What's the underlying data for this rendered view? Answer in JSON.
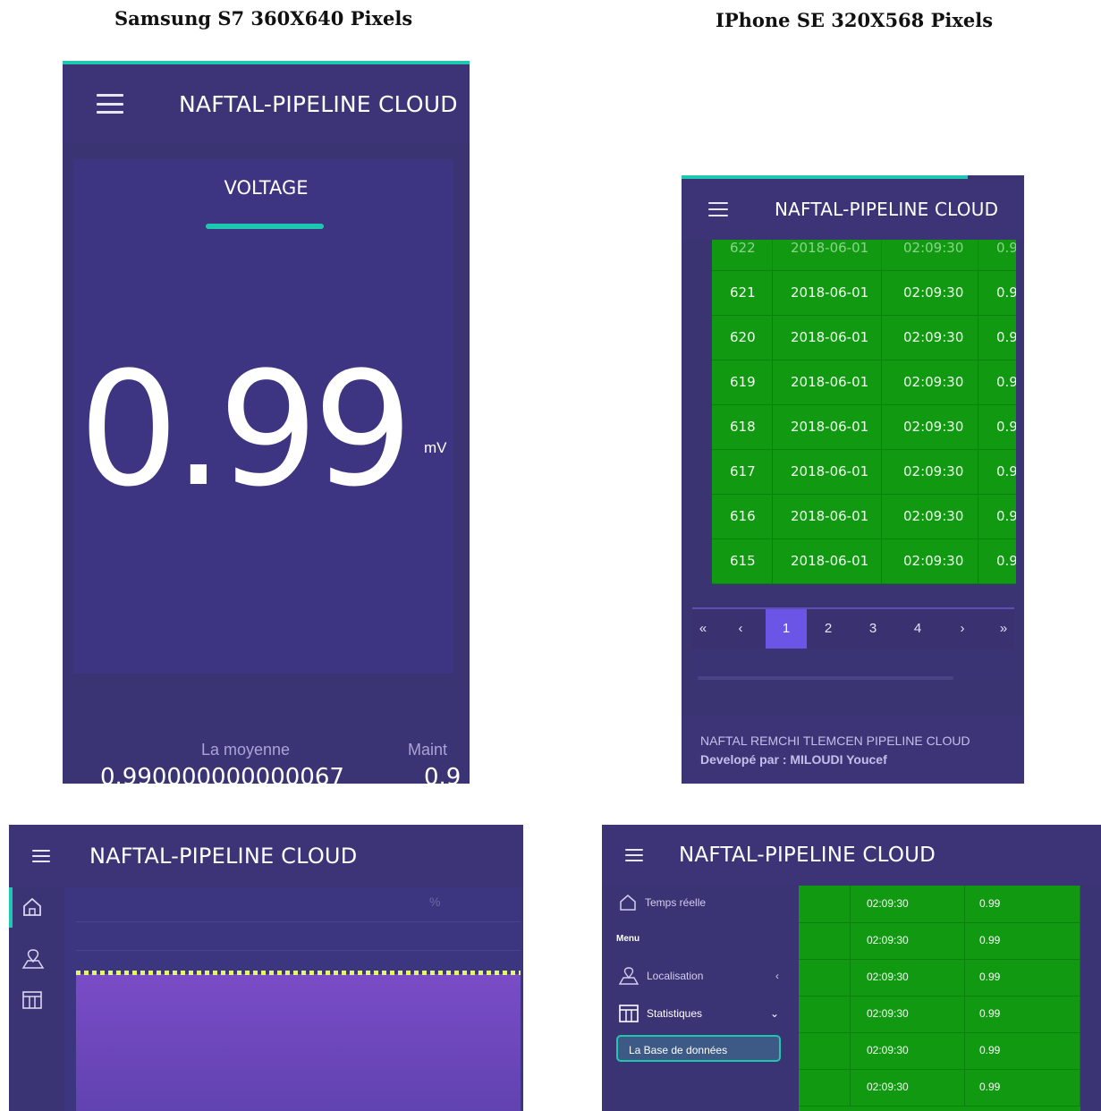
{
  "captions": {
    "samsung": "Samsung S7 360X640 Pixels",
    "iphone": "IPhone SE 320X568 Pixels"
  },
  "app_title": "NAFTAL-PIPELINE CLOUD",
  "colors": {
    "accent": "#1fc7b0",
    "app_bg": "#3a3472",
    "table_green": "#119a11",
    "pager_active": "#6b55e6"
  },
  "samsung": {
    "tab_label": "VOLTAGE",
    "value": "0.99",
    "unit": "mV",
    "avg_label": "La moyenne",
    "maint_label": "Maint",
    "avg_value": "0.990000000000067",
    "maint_value": "0.9"
  },
  "iphone": {
    "rows": [
      {
        "id": "622",
        "date": "2018-06-01",
        "time": "02:09:30",
        "val": "0.9"
      },
      {
        "id": "621",
        "date": "2018-06-01",
        "time": "02:09:30",
        "val": "0.9"
      },
      {
        "id": "620",
        "date": "2018-06-01",
        "time": "02:09:30",
        "val": "0.9"
      },
      {
        "id": "619",
        "date": "2018-06-01",
        "time": "02:09:30",
        "val": "0.9"
      },
      {
        "id": "618",
        "date": "2018-06-01",
        "time": "02:09:30",
        "val": "0.9"
      },
      {
        "id": "617",
        "date": "2018-06-01",
        "time": "02:09:30",
        "val": "0.9"
      },
      {
        "id": "616",
        "date": "2018-06-01",
        "time": "02:09:30",
        "val": "0.9"
      },
      {
        "id": "615",
        "date": "2018-06-01",
        "time": "02:09:30",
        "val": "0.9"
      }
    ],
    "pager": {
      "first": "«",
      "prev": "‹",
      "pages": [
        "1",
        "2",
        "3",
        "4"
      ],
      "next": "›",
      "last": "»",
      "active_page": "1"
    },
    "footer_line1": "NAFTAL REMCHI TLEMCEN PIPELINE CLOUD",
    "footer_line2": "Developé par : MILOUDI Youcef"
  },
  "tablet": {
    "unit_label": "%"
  },
  "desktop": {
    "sidebar": {
      "realtime": "Temps réelle",
      "menu_label": "Menu",
      "localisation": "Localisation",
      "statistiques": "Statistiques",
      "database": "La Base de données"
    },
    "rows": [
      {
        "time": "02:09:30",
        "val": "0.99"
      },
      {
        "time": "02:09:30",
        "val": "0.99"
      },
      {
        "time": "02:09:30",
        "val": "0.99"
      },
      {
        "time": "02:09:30",
        "val": "0.99"
      },
      {
        "time": "02:09:30",
        "val": "0.99"
      },
      {
        "time": "02:09:30",
        "val": "0.99"
      }
    ]
  }
}
